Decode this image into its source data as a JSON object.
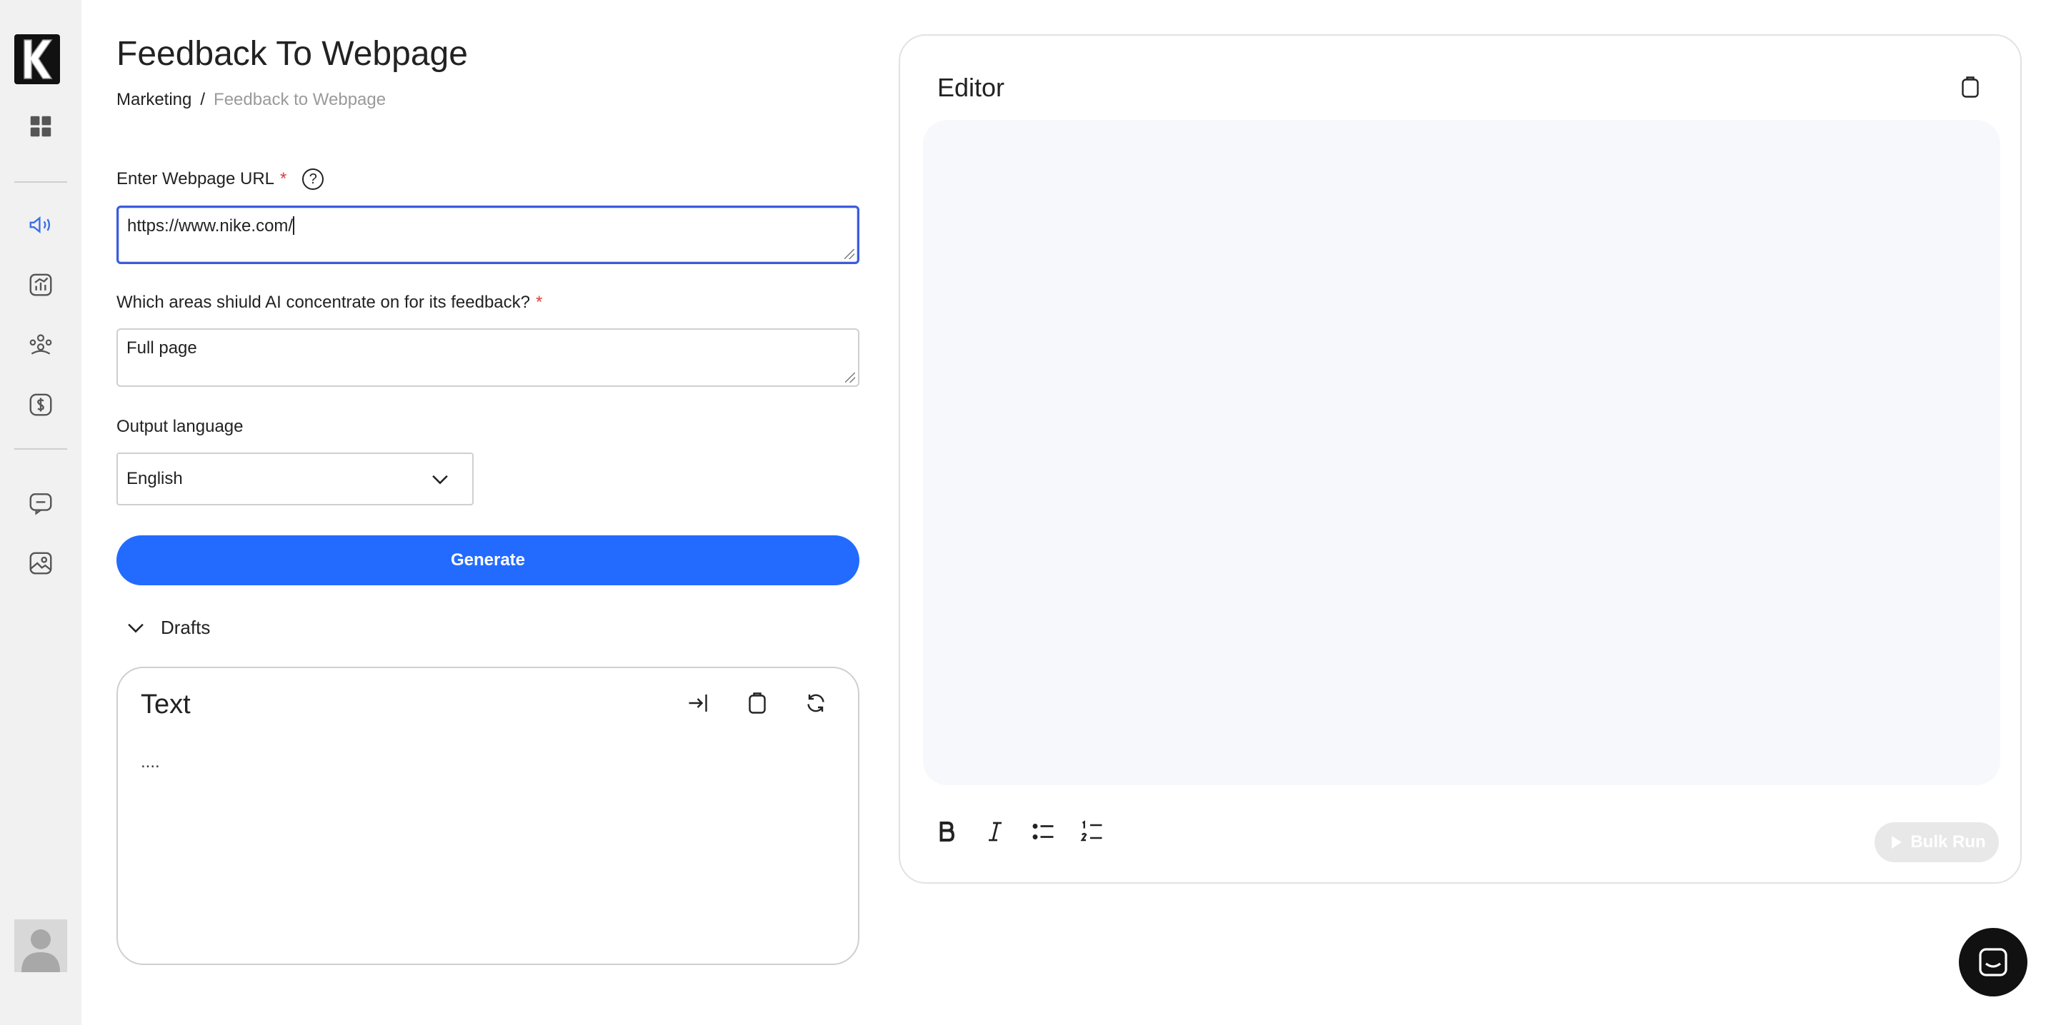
{
  "sidebar": {
    "logo_letter": "K",
    "icons": [
      "dashboard-icon",
      "megaphone-icon",
      "chart-icon",
      "team-icon",
      "dollar-icon",
      "chat-bubble-icon",
      "image-icon"
    ],
    "active_color": "#3b6fe8"
  },
  "page": {
    "title": "Feedback To Webpage",
    "breadcrumb": [
      "Marketing",
      "Feedback to Webpage"
    ],
    "breadcrumb_separator": "/"
  },
  "form": {
    "url_label": "Enter Webpage URL",
    "url_value": "https://www.nike.com/",
    "areas_label": "Which areas shiuld AI concentrate on for its feedback?",
    "areas_value": "Full page",
    "required_marker": "*",
    "help_glyph": "?",
    "language_label": "Output language",
    "language_value": "English",
    "generate_label": "Generate"
  },
  "drafts": {
    "toggle_label": "Drafts",
    "card_title": "Text",
    "card_body": "...."
  },
  "editor": {
    "title": "Editor",
    "bulk_run_label": "Bulk Run"
  },
  "colors": {
    "primary": "#236bff",
    "required": "#e23b3b",
    "editor_bg": "#f7f8fc"
  }
}
